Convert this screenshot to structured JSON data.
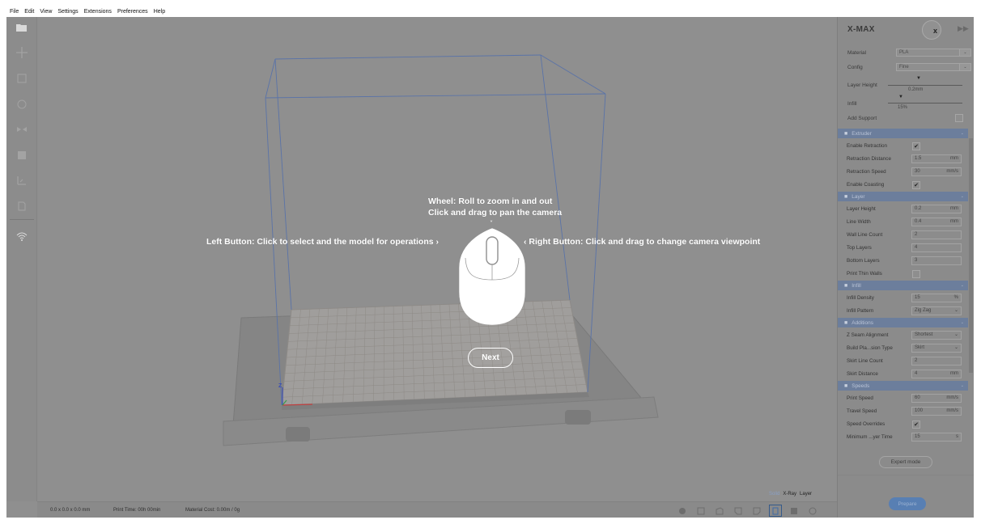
{
  "menu": [
    "File",
    "Edit",
    "View",
    "Settings",
    "Extensions",
    "Preferences",
    "Help"
  ],
  "toolbar": {
    "tools": [
      {
        "icon": "open-folder-icon"
      },
      {
        "icon": "move-icon"
      },
      {
        "icon": "scale-icon"
      },
      {
        "icon": "rotate-icon"
      },
      {
        "icon": "mirror-icon"
      },
      {
        "icon": "per-model-settings-icon"
      },
      {
        "icon": "support-blocker-icon"
      },
      {
        "icon": "layer-view-icon"
      },
      {
        "icon": "wifi-icon"
      }
    ]
  },
  "tutorial": {
    "wheel_line1": "Wheel: Roll to zoom in and out",
    "wheel_line2": "Click and drag to pan the camera",
    "left_button": "Left Button: Click to select and the model for operations",
    "right_button": "Right Button: Click and drag to change camera viewpoint",
    "next_label": "Next"
  },
  "axes": {
    "z": "Z",
    "x": "X"
  },
  "status": {
    "dimensions": "0.0 x 0.0 x 0.0 mm",
    "print_time": "Print Time: 00h 00min",
    "material_cost": "Material Cost: 0.00m / 0g"
  },
  "view_modes": {
    "solid": "Solid",
    "xray": "X-Ray",
    "layer": "Layer"
  },
  "panel": {
    "printer_name": "X-MAX",
    "printer_badge": "x",
    "material_label": "Material",
    "material_value": "PLA",
    "config_label": "Config",
    "config_value": "Fine",
    "layer_height_label": "Layer Height",
    "layer_height_value": "0.2mm",
    "infill_label": "Infill",
    "infill_value": "15%",
    "add_support_label": "Add Support",
    "expert_mode_label": "Expert mode",
    "prepare_label": "Prepare"
  },
  "sections": [
    {
      "title": "Extruder",
      "icon": "extruder-icon",
      "rows": [
        {
          "label": "Enable Retraction",
          "type": "check",
          "value": "✔"
        },
        {
          "label": "Retraction Distance",
          "type": "field",
          "value": "1.5",
          "unit": "mm"
        },
        {
          "label": "Retraction Speed",
          "type": "field",
          "value": "30",
          "unit": "mm/s"
        },
        {
          "label": "Enable Coasting",
          "type": "check",
          "value": "✔"
        }
      ]
    },
    {
      "title": "Layer",
      "icon": "layer-icon",
      "rows": [
        {
          "label": "Layer Height",
          "type": "field",
          "value": "0.2",
          "unit": "mm"
        },
        {
          "label": "Line Width",
          "type": "field",
          "value": "0.4",
          "unit": "mm"
        },
        {
          "label": "Wall Line Count",
          "type": "field",
          "value": "2",
          "unit": ""
        },
        {
          "label": "Top Layers",
          "type": "field",
          "value": "4",
          "unit": ""
        },
        {
          "label": "Bottom Layers",
          "type": "field",
          "value": "3",
          "unit": ""
        },
        {
          "label": "Print Thin Walls",
          "type": "check",
          "value": ""
        }
      ]
    },
    {
      "title": "Infill",
      "icon": "infill-icon",
      "rows": [
        {
          "label": "Infill Density",
          "type": "field",
          "value": "15",
          "unit": "%"
        },
        {
          "label": "Infill Pattern",
          "type": "select",
          "value": "Zig Zag",
          "unit": "⌄"
        }
      ]
    },
    {
      "title": "Additions",
      "icon": "additions-icon",
      "rows": [
        {
          "label": "Z Seam Alignment",
          "type": "select",
          "value": "Shortest",
          "unit": "⌄"
        },
        {
          "label": "Build Pla...sion Type",
          "type": "select",
          "value": "Skirt",
          "unit": "⌄"
        },
        {
          "label": "Skirt Line Count",
          "type": "field",
          "value": "2",
          "unit": ""
        },
        {
          "label": "Skirt Distance",
          "type": "field",
          "value": "4",
          "unit": "mm"
        }
      ]
    },
    {
      "title": "Speeds",
      "icon": "speeds-icon",
      "rows": [
        {
          "label": "Print Speed",
          "type": "field",
          "value": "60",
          "unit": "mm/s"
        },
        {
          "label": "Travel Speed",
          "type": "field",
          "value": "100",
          "unit": "mm/s"
        },
        {
          "label": "Speed Overrides",
          "type": "check",
          "value": "✔"
        },
        {
          "label": "Minimum ...yer Time",
          "type": "select",
          "value": "15",
          "unit": "s"
        }
      ]
    }
  ]
}
